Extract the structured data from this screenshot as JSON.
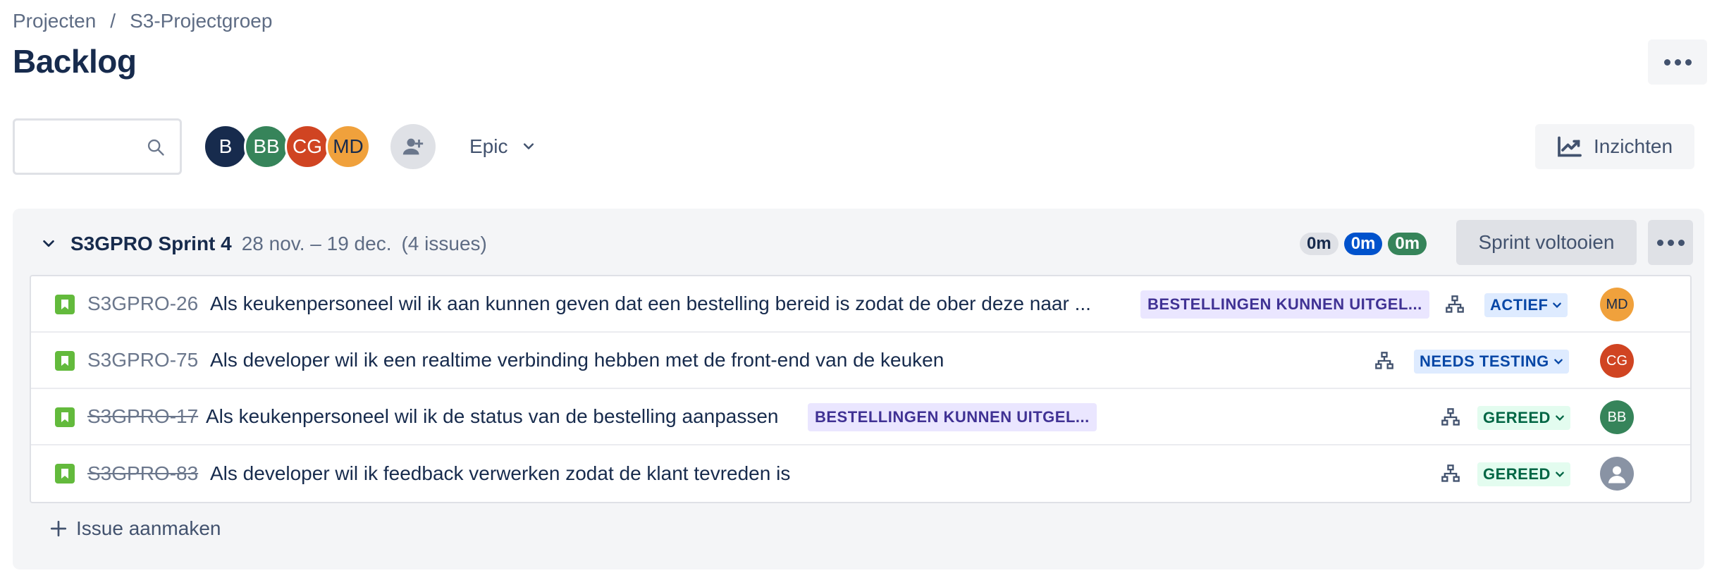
{
  "breadcrumb": {
    "root": "Projecten",
    "separator": "/",
    "project": "S3-Projectgroep"
  },
  "page": {
    "title": "Backlog"
  },
  "toolbar": {
    "search_placeholder": "",
    "avatars": [
      {
        "initials": "B",
        "color": "#172b4d"
      },
      {
        "initials": "BB",
        "color": "#36845a"
      },
      {
        "initials": "CG",
        "color": "#d04422"
      },
      {
        "initials": "MD",
        "color": "#f0a13c"
      }
    ],
    "epic_label": "Epic",
    "insights_label": "Inzichten"
  },
  "sprint": {
    "name": "S3GPRO Sprint 4",
    "dates": "28 nov. – 19 dec.",
    "count": "(4 issues)",
    "estimates": [
      {
        "label": "0m",
        "bg": "#dfe1e6",
        "fg": "#172b4d"
      },
      {
        "label": "0m",
        "bg": "#0052cc",
        "fg": "#ffffff"
      },
      {
        "label": "0m",
        "bg": "#36845a",
        "fg": "#ffffff"
      }
    ],
    "complete_label": "Sprint voltooien",
    "create_label": "Issue aanmaken",
    "issues": [
      {
        "key": "S3GPRO-26",
        "summary": "Als keukenpersoneel wil ik aan kunnen geven dat een bestelling bereid is zodat de ober deze naar ...",
        "epic": "BESTELLINGEN KUNNEN UITGEL...",
        "status": "ACTIEF",
        "assignee": "MD",
        "done": false
      },
      {
        "key": "S3GPRO-75",
        "summary": "Als developer wil ik een realtime verbinding hebben met de front-end van de keuken",
        "epic": "",
        "status": "NEEDS TESTING",
        "assignee": "CG",
        "done": false
      },
      {
        "key": "S3GPRO-17",
        "summary": "Als keukenpersoneel wil ik de status van de bestelling aanpassen",
        "epic": "BESTELLINGEN KUNNEN UITGEL...",
        "status": "GEREED",
        "assignee": "BB",
        "done": true
      },
      {
        "key": "S3GPRO-83",
        "summary": "Als developer wil ik feedback verwerken zodat de klant tevreden is",
        "epic": "",
        "status": "GEREED",
        "assignee": "",
        "done": true
      }
    ]
  }
}
